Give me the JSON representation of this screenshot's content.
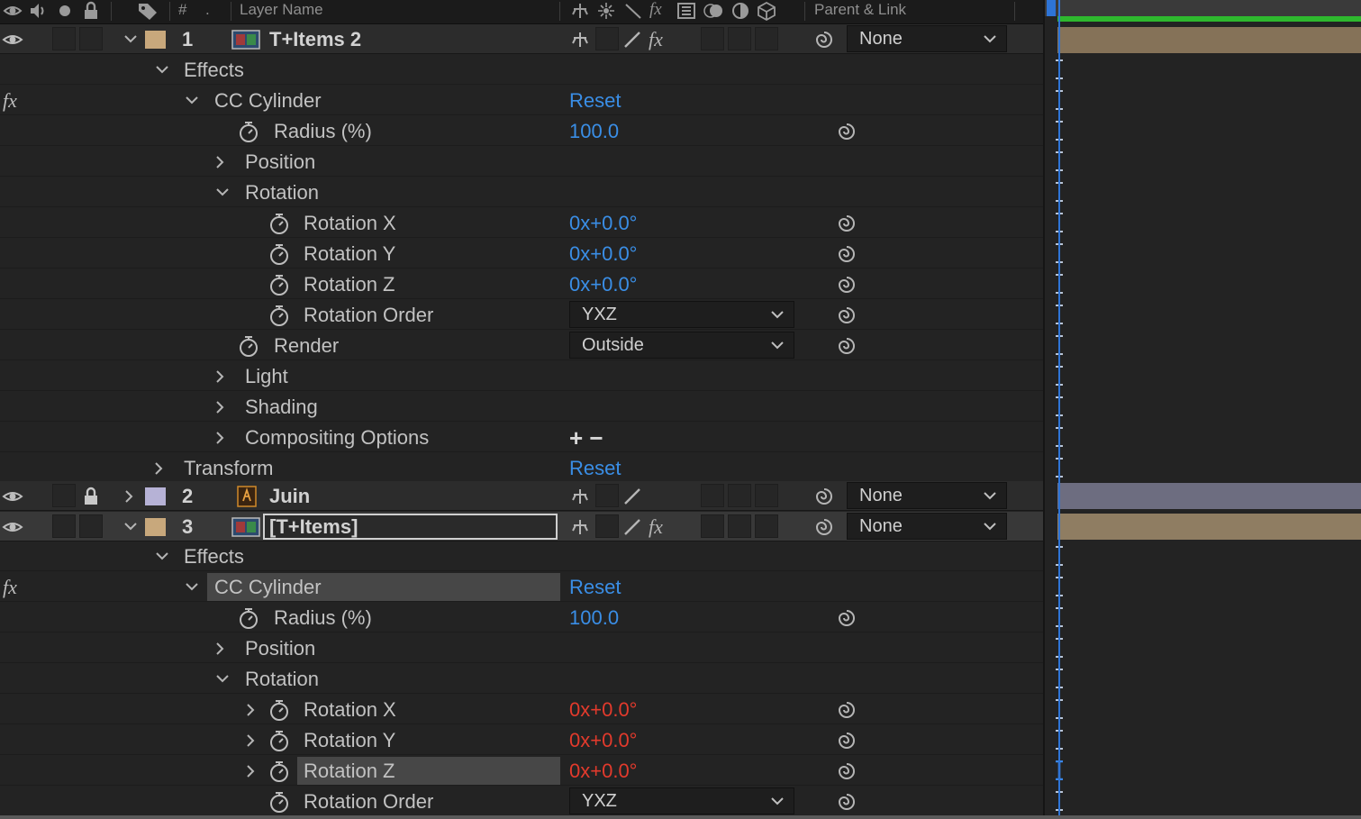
{
  "colors": {
    "value_blue": "#3a8ee6",
    "value_red": "#e23a2c",
    "label_tan": "#c8a87c",
    "label_lavender": "#b6b2d6",
    "timeline_green": "#2eb82e",
    "playhead_blue": "#2e74d6"
  },
  "header": {
    "number_col": "#",
    "dot": ".",
    "layer_name": "Layer Name",
    "parent_link": "Parent & Link"
  },
  "common": {
    "effects": "Effects",
    "reset": "Reset",
    "fx": "fx"
  },
  "layer1": {
    "number": "1",
    "name": "T+Items 2",
    "parent": "None",
    "effect_name": "CC Cylinder",
    "radius_label": "Radius (%)",
    "radius_value": "100.0",
    "position_label": "Position",
    "rotation_label": "Rotation",
    "rot_x_label": "Rotation X",
    "rot_y_label": "Rotation Y",
    "rot_z_label": "Rotation Z",
    "rot_turns": "0x",
    "rot_x_value": "+0.0°",
    "rot_y_value": "+0.0°",
    "rot_z_value": "+0.0°",
    "rot_order_label": "Rotation Order",
    "rot_order_value": "YXZ",
    "render_label": "Render",
    "render_value": "Outside",
    "light_label": "Light",
    "shading_label": "Shading",
    "compositing_label": "Compositing Options",
    "compositing_ops": "+ −",
    "transform_label": "Transform"
  },
  "layer2": {
    "number": "2",
    "name": "Juin",
    "parent": "None"
  },
  "layer3": {
    "number": "3",
    "name": "[T+Items]",
    "parent": "None",
    "effect_name": "CC Cylinder",
    "radius_label": "Radius (%)",
    "radius_value": "100.0",
    "position_label": "Position",
    "rotation_label": "Rotation",
    "rot_x_label": "Rotation X",
    "rot_y_label": "Rotation Y",
    "rot_z_label": "Rotation Z",
    "rot_turns": "0x",
    "rot_x_value": "+0.0°",
    "rot_y_value": "+0.0°",
    "rot_z_value": "+0.0°",
    "rot_order_label": "Rotation Order",
    "rot_order_value": "YXZ"
  },
  "icons": {
    "eye": "eye-icon",
    "audio": "speaker-icon",
    "solo": "solo-dot-icon",
    "lock": "lock-icon",
    "label": "tag-icon",
    "stopwatch": "stopwatch-icon",
    "pickwhip": "pickwhip-icon",
    "chevron": "chevron-icon"
  }
}
